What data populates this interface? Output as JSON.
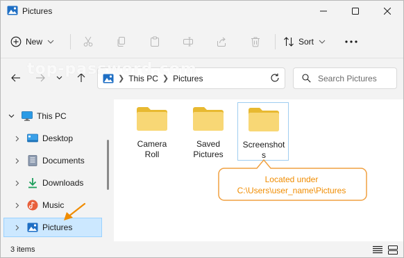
{
  "window": {
    "title": "Pictures"
  },
  "toolbar": {
    "new_label": "New",
    "sort_label": "Sort"
  },
  "address": {
    "crumbs": [
      "This PC",
      "Pictures"
    ]
  },
  "search": {
    "placeholder": "Search Pictures"
  },
  "watermark": "top-password.com",
  "sidebar": {
    "items": [
      {
        "label": "This PC",
        "icon": "monitor-icon"
      },
      {
        "label": "Desktop",
        "icon": "desktop-icon"
      },
      {
        "label": "Documents",
        "icon": "documents-icon"
      },
      {
        "label": "Downloads",
        "icon": "download-icon"
      },
      {
        "label": "Music",
        "icon": "music-icon"
      },
      {
        "label": "Pictures",
        "icon": "pictures-icon",
        "selected": true
      }
    ]
  },
  "folders": [
    {
      "name_line1": "Camera",
      "name_line2": "Roll"
    },
    {
      "name_line1": "Saved",
      "name_line2": "Pictures"
    },
    {
      "name_line1": "Screenshot",
      "name_line2": "s"
    }
  ],
  "callout": {
    "line1": "Located under",
    "line2": "C:\\Users\\user_name\\Pictures"
  },
  "status": {
    "item_count": "3 items"
  },
  "colors": {
    "accent": "#0067c0",
    "selection_bg": "#cce8ff",
    "folder_yellow": "#f8d775",
    "folder_tab": "#e8b931",
    "callout_orange": "#f08c00"
  }
}
